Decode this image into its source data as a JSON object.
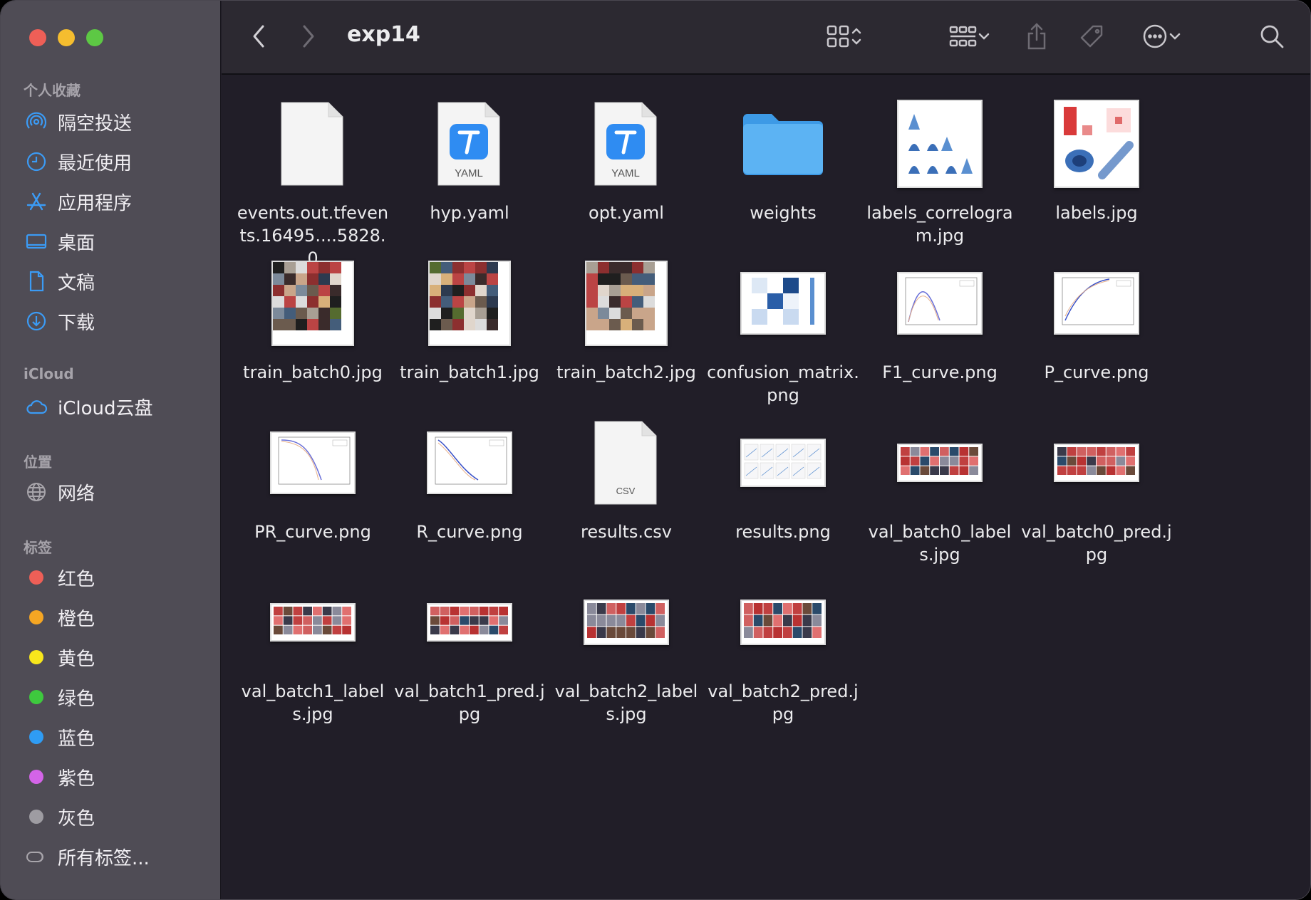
{
  "window": {
    "title": "exp14"
  },
  "sidebar": {
    "favorites_header": "个人收藏",
    "favorites": [
      {
        "label": "隔空投送",
        "icon": "airdrop-icon"
      },
      {
        "label": "最近使用",
        "icon": "clock-icon"
      },
      {
        "label": "应用程序",
        "icon": "applications-icon"
      },
      {
        "label": "桌面",
        "icon": "desktop-icon"
      },
      {
        "label": "文稿",
        "icon": "document-icon"
      },
      {
        "label": "下载",
        "icon": "download-icon"
      }
    ],
    "icloud_header": "iCloud",
    "icloud": [
      {
        "label": "iCloud云盘",
        "icon": "cloud-icon"
      }
    ],
    "locations_header": "位置",
    "locations": [
      {
        "label": "网络",
        "icon": "globe-icon"
      }
    ],
    "tags_header": "标签",
    "tags": [
      {
        "label": "红色",
        "color": "#ee5f57"
      },
      {
        "label": "橙色",
        "color": "#f5a623"
      },
      {
        "label": "黄色",
        "color": "#f8e71c"
      },
      {
        "label": "绿色",
        "color": "#3ec93e"
      },
      {
        "label": "蓝色",
        "color": "#2f9cf4"
      },
      {
        "label": "紫色",
        "color": "#d464e8"
      },
      {
        "label": "灰色",
        "color": "#9e9ca2"
      }
    ],
    "all_tags": "所有标签..."
  },
  "files": [
    {
      "name": "events.out.tfevents.16495....5828.0",
      "kind": "generic"
    },
    {
      "name": "hyp.yaml",
      "kind": "yaml",
      "badge": "YAML"
    },
    {
      "name": "opt.yaml",
      "kind": "yaml",
      "badge": "YAML"
    },
    {
      "name": "weights",
      "kind": "folder"
    },
    {
      "name": "labels_correlogram.jpg",
      "kind": "correlogram"
    },
    {
      "name": "labels.jpg",
      "kind": "labels"
    },
    {
      "name": "train_batch0.jpg",
      "kind": "mosaic"
    },
    {
      "name": "train_batch1.jpg",
      "kind": "mosaic"
    },
    {
      "name": "train_batch2.jpg",
      "kind": "mosaic"
    },
    {
      "name": "confusion_matrix.png",
      "kind": "confusion"
    },
    {
      "name": "F1_curve.png",
      "kind": "curve-f1"
    },
    {
      "name": "P_curve.png",
      "kind": "curve-p"
    },
    {
      "name": "PR_curve.png",
      "kind": "curve-pr"
    },
    {
      "name": "R_curve.png",
      "kind": "curve-r"
    },
    {
      "name": "results.csv",
      "kind": "csv",
      "badge": "CSV"
    },
    {
      "name": "results.png",
      "kind": "results"
    },
    {
      "name": "val_batch0_labels.jpg",
      "kind": "strip"
    },
    {
      "name": "val_batch0_pred.jpg",
      "kind": "strip"
    },
    {
      "name": "val_batch1_labels.jpg",
      "kind": "strip"
    },
    {
      "name": "val_batch1_pred.jpg",
      "kind": "strip"
    },
    {
      "name": "val_batch2_labels.jpg",
      "kind": "strip-tall"
    },
    {
      "name": "val_batch2_pred.jpg",
      "kind": "strip-tall"
    }
  ]
}
